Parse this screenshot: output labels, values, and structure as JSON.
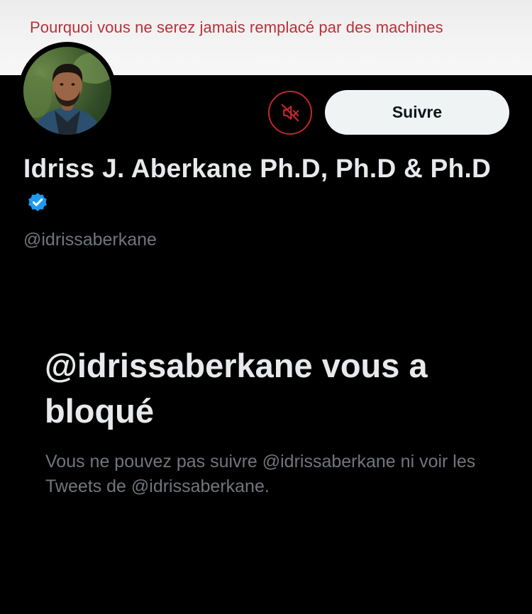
{
  "banner": {
    "text": "Pourquoi vous ne serez jamais remplacé par des machines"
  },
  "profile": {
    "display_name": "Idriss J. Aberkane Ph.D, Ph.D & Ph.D",
    "handle": "@idrissaberkane",
    "verified": true,
    "verified_icon": "verified-badge-icon"
  },
  "actions": {
    "mute_icon": "muted-speaker-icon",
    "follow_label": "Suivre"
  },
  "blocked": {
    "title": "@idrissaberkane vous a bloqué",
    "description": "Vous ne pouvez pas suivre @idrissaberkane ni voir les Tweets de @idrissaberkane."
  },
  "colors": {
    "background": "#000000",
    "banner_text": "#b8313a",
    "mute_accent": "#c0272d",
    "verified_blue": "#1d9bf0",
    "follow_button_bg": "#eff3f4",
    "secondary_text": "#71767b",
    "primary_text": "#e7e9ea"
  }
}
